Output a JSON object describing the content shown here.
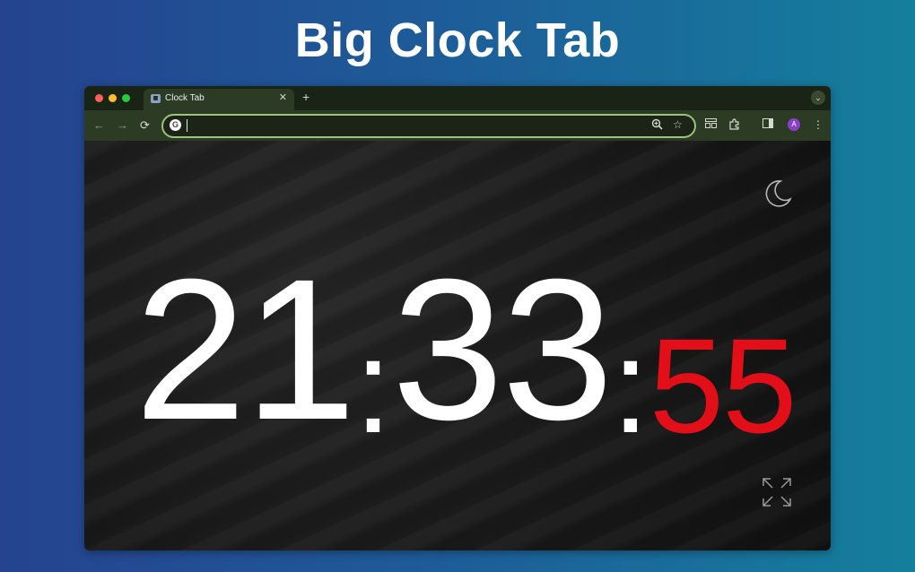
{
  "headline": "Big Clock Tab",
  "browser": {
    "tab": {
      "title": "Clock Tab",
      "favicon": "clock-favicon"
    },
    "new_tab_symbol": "+",
    "close_symbol": "✕",
    "tab_menu_symbol": "⌄",
    "toolbar": {
      "back_symbol": "←",
      "forward_symbol": "→",
      "reload_symbol": "⟳",
      "omnibox_value": "",
      "avatar_initial": "A",
      "menu_symbol": "⋮"
    }
  },
  "clock": {
    "hours": "21",
    "minutes": "33",
    "seconds": "55",
    "separator": ":",
    "seconds_color": "#e30f18"
  },
  "icons": [
    "moon-icon",
    "fullscreen-icon",
    "zoom-icon",
    "star-icon",
    "reading-list-icon",
    "extensions-icon",
    "side-panel-icon",
    "google-icon"
  ]
}
